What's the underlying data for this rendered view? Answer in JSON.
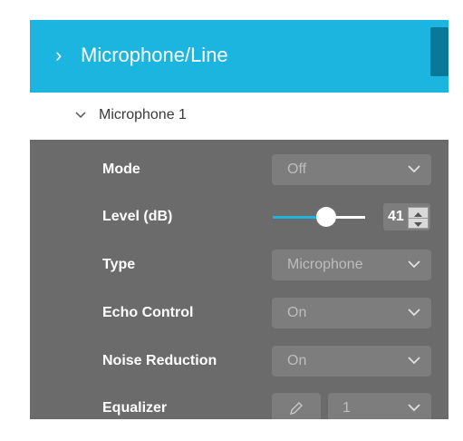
{
  "header": {
    "title": "Microphone/Line",
    "chevron_icon": "chevron-right-icon"
  },
  "subsection": {
    "label": "Microphone 1",
    "chevron_icon": "chevron-down-icon"
  },
  "settings": {
    "mode": {
      "label": "Mode",
      "value": "Off"
    },
    "level": {
      "label": "Level (dB)",
      "value": "41",
      "slider_fraction": 0.5
    },
    "type": {
      "label": "Type",
      "value": "Microphone"
    },
    "echo_control": {
      "label": "Echo Control",
      "value": "On"
    },
    "noise_reduction": {
      "label": "Noise Reduction",
      "value": "On"
    },
    "equalizer": {
      "label": "Equalizer",
      "value": "1"
    }
  },
  "colors": {
    "accent": "#1cb5df",
    "panel_dark": "#6b6b6b",
    "control_bg": "#7d7d7d",
    "control_text": "#bdbdbd"
  }
}
